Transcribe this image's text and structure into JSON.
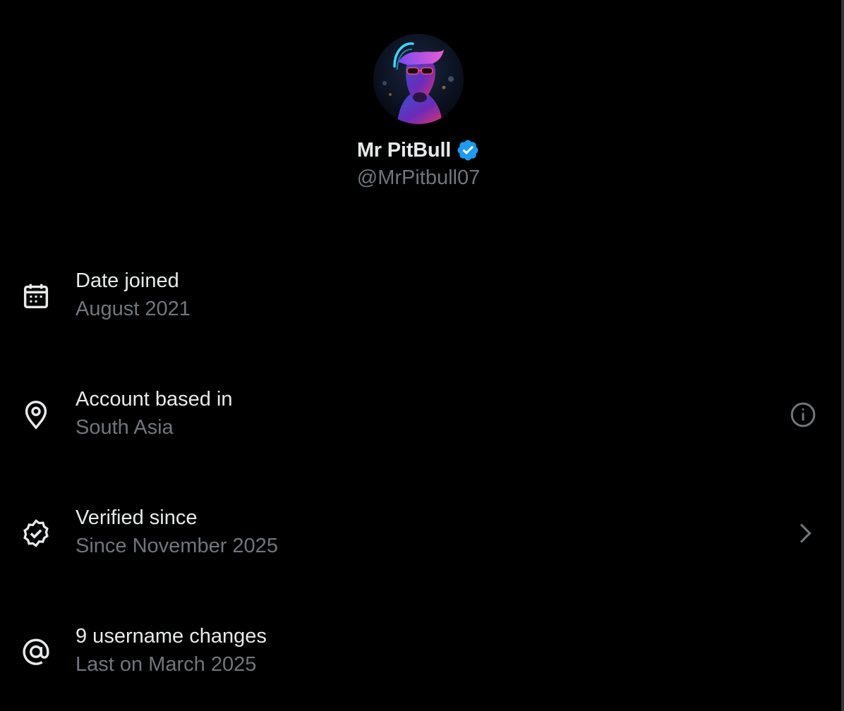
{
  "profile": {
    "display_name": "Mr PitBull",
    "handle": "@MrPitbull07",
    "verified": true
  },
  "colors": {
    "background": "#000000",
    "primary_text": "#e7e9ea",
    "secondary_text": "#71767b",
    "verified_blue": "#1d9bf0"
  },
  "rows": [
    {
      "icon": "calendar-icon",
      "title": "Date joined",
      "value": "August 2021",
      "action": null
    },
    {
      "icon": "location-pin-icon",
      "title": "Account based in",
      "value": "South Asia",
      "action": "info-icon"
    },
    {
      "icon": "verified-check-icon",
      "title": "Verified since",
      "value": "Since November 2025",
      "action": "chevron-right-icon"
    },
    {
      "icon": "at-sign-icon",
      "title": "9 username changes",
      "value": "Last on March 2025",
      "action": null
    }
  ]
}
